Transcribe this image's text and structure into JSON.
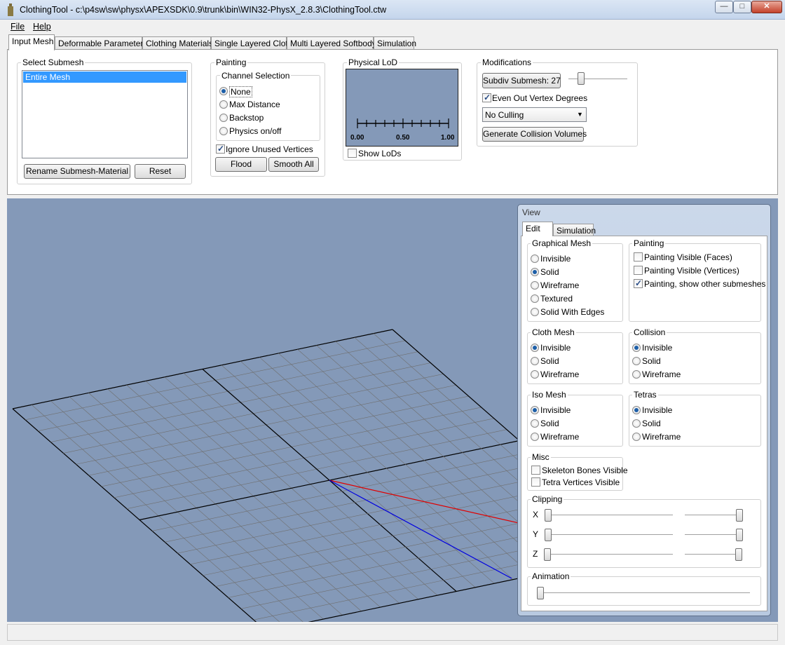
{
  "window": {
    "title": "ClothingTool - c:\\p4sw\\sw\\physx\\APEXSDK\\0.9\\trunk\\bin\\WIN32-PhysX_2.8.3\\ClothingTool.ctw"
  },
  "menu": {
    "file": "File",
    "help": "Help"
  },
  "tabs": [
    "Input Mesh",
    "Deformable Parameters",
    "Clothing Materials",
    "Single Layered Cloth",
    "Multi Layered Softbody",
    "Simulation"
  ],
  "select_submesh": {
    "title": "Select Submesh",
    "items": [
      "Entire Mesh"
    ],
    "rename_button": "Rename Submesh-Material",
    "reset_button": "Reset"
  },
  "painting": {
    "title": "Painting",
    "channel_title": "Channel Selection",
    "channels": [
      "None",
      "Max Distance",
      "Backstop",
      "Physics on/off"
    ],
    "selected_channel": "None",
    "ignore_unused": "Ignore Unused Vertices",
    "ignore_unused_checked": true,
    "flood_button": "Flood",
    "smooth_button": "Smooth All"
  },
  "physical_lod": {
    "title": "Physical LoD",
    "tick_labels": [
      "0.00",
      "0.50",
      "1.00"
    ],
    "show_lods": "Show LoDs",
    "show_lods_checked": false
  },
  "modifications": {
    "title": "Modifications",
    "subdiv_button": "Subdiv Submesh: 27",
    "even_out": "Even Out Vertex Degrees",
    "even_out_checked": true,
    "culling_value": "No Culling",
    "generate_button": "Generate Collision Volumes"
  },
  "view_panel": {
    "title": "View",
    "tabs": [
      "Edit",
      "Simulation"
    ],
    "graphical_mesh": {
      "title": "Graphical Mesh",
      "options": [
        "Invisible",
        "Solid",
        "Wireframe",
        "Textured",
        "Solid With Edges"
      ],
      "selected": "Solid"
    },
    "painting": {
      "title": "Painting",
      "options": [
        "Painting Visible (Faces)",
        "Painting Visible (Vertices)",
        "Painting, show other submeshes"
      ],
      "checked": [
        false,
        false,
        true
      ]
    },
    "cloth_mesh": {
      "title": "Cloth Mesh",
      "options": [
        "Invisible",
        "Solid",
        "Wireframe"
      ],
      "selected": "Invisible"
    },
    "collision": {
      "title": "Collision",
      "options": [
        "Invisible",
        "Solid",
        "Wireframe"
      ],
      "selected": "Invisible"
    },
    "iso_mesh": {
      "title": "Iso Mesh",
      "options": [
        "Invisible",
        "Solid",
        "Wireframe"
      ],
      "selected": "Invisible"
    },
    "tetras": {
      "title": "Tetras",
      "options": [
        "Invisible",
        "Solid",
        "Wireframe"
      ],
      "selected": "Invisible"
    },
    "misc": {
      "title": "Misc",
      "options": [
        "Skeleton Bones Visible",
        "Tetra Vertices Visible"
      ],
      "checked": [
        false,
        false
      ]
    },
    "clipping": {
      "title": "Clipping",
      "axes": [
        "X",
        "Y",
        "Z"
      ]
    },
    "animation": {
      "title": "Animation"
    }
  },
  "colors": {
    "viewport": "#8499b8",
    "selection": "#3399ff",
    "axis_x": "#e00000",
    "axis_z": "#0000e0"
  }
}
